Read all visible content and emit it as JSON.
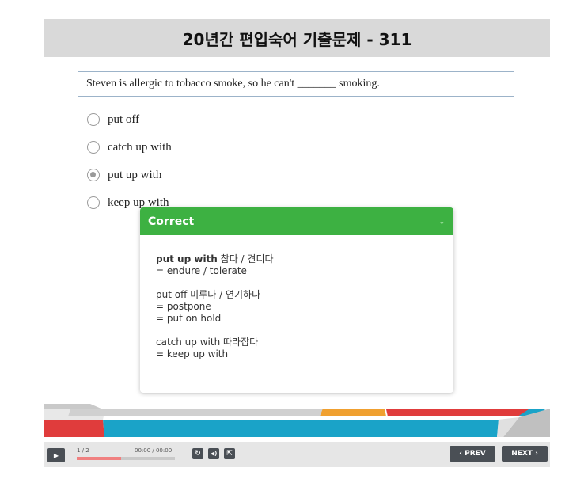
{
  "title": "20년간 편입숙어 기출문제 - 311",
  "question": "Steven is allergic to tobacco smoke, so he can't _______ smoking.",
  "options": [
    {
      "label": "put off",
      "selected": false
    },
    {
      "label": "catch up with",
      "selected": false
    },
    {
      "label": "put up with",
      "selected": true
    },
    {
      "label": "keep up with",
      "selected": false
    }
  ],
  "feedback": {
    "header": "Correct",
    "answer_term": "put up with",
    "answer_meaning": " 참다 / 견디다",
    "lines1": [
      "= endure / tolerate"
    ],
    "block2_title": "put off 미루다 / 연기하다",
    "lines2": [
      "= postpone",
      "= put on hold"
    ],
    "block3_title": "catch up with 따라잡다",
    "lines3": [
      "= keep up with"
    ]
  },
  "controls": {
    "slide_counter": "1 / 2",
    "time": "00:00 / 00:00",
    "progress": 0.45,
    "prev_label": "‹ PREV",
    "next_label": "NEXT ›"
  },
  "colors": {
    "correct_green": "#3db142",
    "accent_red": "#e03c3c",
    "accent_blue": "#1aa3c8",
    "accent_orange": "#f0a030"
  }
}
